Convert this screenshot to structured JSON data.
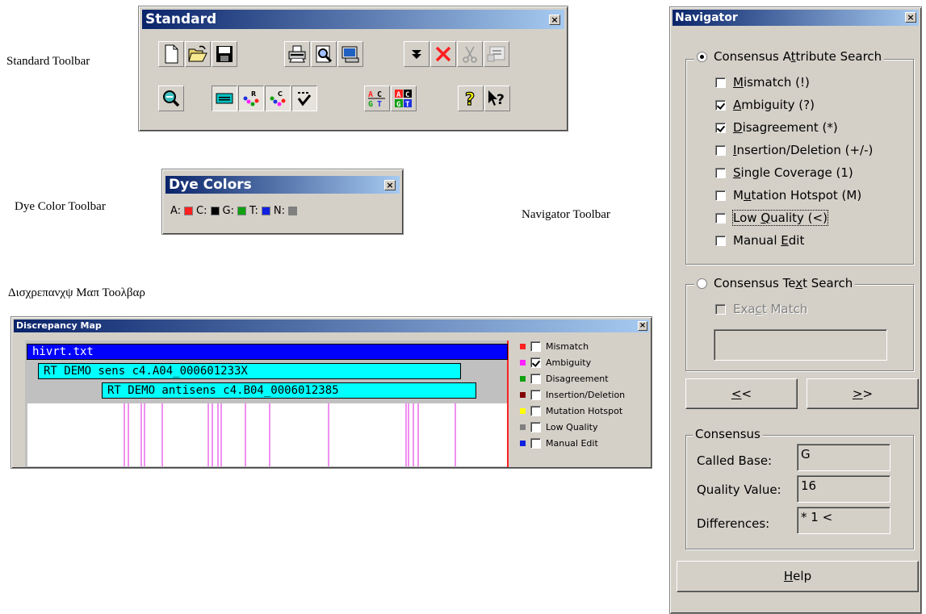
{
  "captions": {
    "standard": "Standard Toolbar",
    "dye": "Dye Color Toolbar",
    "navigator": "Navigator Toolbar",
    "discrepancy": "Δισχρεπανχψ Μαπ Τοολβαρ"
  },
  "standard_toolbar": {
    "title": "Standard",
    "close": "×",
    "row1_buttons": [
      "new-document",
      "open-folder",
      "save-disk",
      "print",
      "print-preview",
      "page-setup",
      "dropdown-arrow",
      "delete-x",
      "cut-scissors",
      "properties"
    ],
    "row2_buttons": [
      "zoom",
      "text-view",
      "reverse-seq",
      "complement-seq",
      "check-list",
      "align-abc",
      "align-abc-color",
      "help-question",
      "context-help"
    ]
  },
  "dye_toolbar": {
    "title": "Dye Colors",
    "close": "×",
    "dyes": [
      {
        "label": "A:",
        "color": "#ff2020"
      },
      {
        "label": "C:",
        "color": "#000000"
      },
      {
        "label": "G:",
        "color": "#10a010"
      },
      {
        "label": "T:",
        "color": "#1020e0"
      },
      {
        "label": "N:",
        "color": "#808080"
      }
    ]
  },
  "discrepancy_map": {
    "title": "Discrepancy Map",
    "close": "×",
    "reference": "hivrt.txt",
    "reads": [
      "RT DEMO sens c4.A04_000601233X",
      "RT DEMO antisens c4.B04_0006012385"
    ],
    "legend": [
      {
        "label": "Mismatch",
        "color": "#ff2020",
        "checked": false
      },
      {
        "label": "Ambiguity",
        "color": "#ff20ff",
        "checked": true
      },
      {
        "label": "Disagreement",
        "color": "#10a010",
        "checked": false
      },
      {
        "label": "Insertion/Deletion",
        "color": "#800000",
        "checked": false
      },
      {
        "label": "Mutation Hotspot",
        "color": "#ffff00",
        "checked": false
      },
      {
        "label": "Low Quality",
        "color": "#808080",
        "checked": false
      },
      {
        "label": "Manual Edit",
        "color": "#1020e0",
        "checked": false
      }
    ],
    "marker_color": "#e020e0"
  },
  "navigator": {
    "title": "Navigator",
    "close": "×",
    "attribute_search": {
      "label_pre": "Consensus A",
      "label_u": "t",
      "label_post": "tribute Search",
      "selected": true,
      "items": [
        {
          "pre": "",
          "u": "M",
          "post": "ismatch (!)",
          "checked": false
        },
        {
          "pre": "",
          "u": "A",
          "post": "mbiguity (?)",
          "checked": true
        },
        {
          "pre": "",
          "u": "D",
          "post": "isagreement (*)",
          "checked": true
        },
        {
          "pre": "",
          "u": "I",
          "post": "nsertion/Deletion (+/-)",
          "checked": false
        },
        {
          "pre": "",
          "u": "S",
          "post": "ingle Coverage (1)",
          "checked": false
        },
        {
          "pre": "M",
          "u": "u",
          "post": "tation Hotspot (M)",
          "checked": false
        },
        {
          "pre": "Low ",
          "u": "Q",
          "post": "uality (<)",
          "checked": false
        },
        {
          "pre": "Manual ",
          "u": "E",
          "post": "dit",
          "checked": false
        }
      ]
    },
    "text_search": {
      "label_pre": "Consensus Te",
      "label_u": "x",
      "label_post": "t Search",
      "selected": false,
      "exact_pre": "Exa",
      "exact_u": "c",
      "exact_post": "t Match",
      "value": ""
    },
    "prev_u": "<",
    "prev_rest": "<",
    "next_u": ">",
    "next_rest": ">",
    "consensus": {
      "legend": "Consensus",
      "called_base_label": "Called Base:",
      "called_base": "G",
      "quality_label": "Quality Value:",
      "quality": "16",
      "differences_label": "Differences:",
      "differences": "* 1 <"
    },
    "help_u": "H",
    "help_rest": "elp"
  }
}
